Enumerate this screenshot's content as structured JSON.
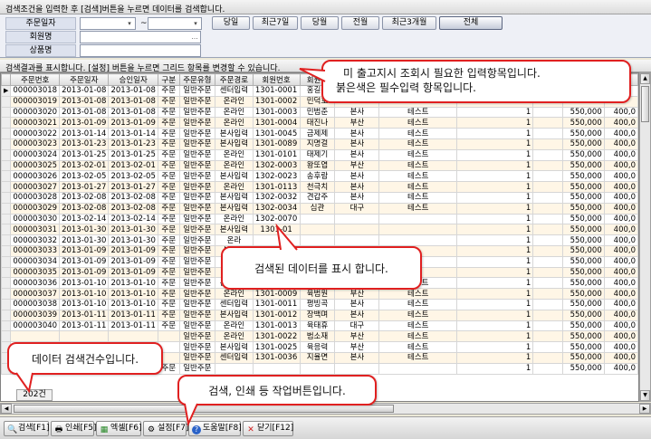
{
  "top_hint": "검색조건을 입력한 후 [검색]버튼을 누르면 데이터를 검색합니다.",
  "search": {
    "order_date_label": "주문일자",
    "member_label": "회원명",
    "product_label": "상품명",
    "tilde": "~",
    "dropdown_glyph": "▾",
    "member_btn_glyph": "…",
    "period_buttons": [
      "당일",
      "최근7일",
      "당월",
      "전월",
      "최근3개월",
      "전체"
    ]
  },
  "grid_hint": "검색결과를 표시합니다. [설정] 버튼을 누르면 그리드 항목를 변경할 수 있습니다.",
  "grid": {
    "indicator": "▶",
    "columns": [
      "주문번호",
      "주문일자",
      "승인일자",
      "구분",
      "주문유형",
      "주문경로",
      "회원번호",
      "회원명",
      "",
      "",
      "",
      "",
      "",
      ""
    ],
    "rows": [
      [
        "000003018",
        "2013-01-08",
        "2013-01-08",
        "주문",
        "일반주문",
        "센터입력",
        "1301-0001",
        "홍길동",
        "",
        "",
        "",
        "",
        "",
        ""
      ],
      [
        "000003019",
        "2013-01-08",
        "2013-01-08",
        "주문",
        "일반주문",
        "온라인",
        "1301-0002",
        "민덕호",
        "",
        "",
        "",
        "",
        "",
        ""
      ],
      [
        "000003020",
        "2013-01-08",
        "2013-01-08",
        "주문",
        "일반주문",
        "온라인",
        "1301-0003",
        "민범춘",
        "본사",
        "테스트",
        "1",
        "",
        "550,000",
        "400,0"
      ],
      [
        "000003021",
        "2013-01-09",
        "2013-01-09",
        "주문",
        "일반주문",
        "온라인",
        "1301-0004",
        "태진나",
        "부산",
        "테스트",
        "1",
        "",
        "550,000",
        "400,0"
      ],
      [
        "000003022",
        "2013-01-14",
        "2013-01-14",
        "주문",
        "일반주문",
        "본사입력",
        "1301-0045",
        "금제제",
        "본사",
        "테스트",
        "1",
        "",
        "550,000",
        "400,0"
      ],
      [
        "000003023",
        "2013-01-23",
        "2013-01-23",
        "주문",
        "일반주문",
        "본사입력",
        "1301-0089",
        "지명걸",
        "본사",
        "테스트",
        "1",
        "",
        "550,000",
        "400,0"
      ],
      [
        "000003024",
        "2013-01-25",
        "2013-01-25",
        "주문",
        "일반주문",
        "온라인",
        "1301-0101",
        "태제기",
        "본사",
        "테스트",
        "1",
        "",
        "550,000",
        "400,0"
      ],
      [
        "000003025",
        "2013-02-01",
        "2013-02-01",
        "주문",
        "일반주문",
        "온라인",
        "1302-0003",
        "왕또엽",
        "부산",
        "테스트",
        "1",
        "",
        "550,000",
        "400,0"
      ],
      [
        "000003026",
        "2013-02-05",
        "2013-02-05",
        "주문",
        "일반주문",
        "본사입력",
        "1302-0023",
        "송후람",
        "본사",
        "테스트",
        "1",
        "",
        "550,000",
        "400,0"
      ],
      [
        "000003027",
        "2013-01-27",
        "2013-01-27",
        "주문",
        "일반주문",
        "온라인",
        "1301-0113",
        "천극치",
        "본사",
        "테스트",
        "1",
        "",
        "550,000",
        "400,0"
      ],
      [
        "000003028",
        "2013-02-08",
        "2013-02-08",
        "주문",
        "일반주문",
        "본사입력",
        "1302-0032",
        "견갑주",
        "본사",
        "테스트",
        "1",
        "",
        "550,000",
        "400,0"
      ],
      [
        "000003029",
        "2013-02-08",
        "2013-02-08",
        "주문",
        "일반주문",
        "본사입력",
        "1302-0034",
        "심관",
        "대구",
        "테스트",
        "1",
        "",
        "550,000",
        "400,0"
      ],
      [
        "000003030",
        "2013-02-14",
        "2013-02-14",
        "주문",
        "일반주문",
        "온라인",
        "1302-0070",
        "",
        "",
        "",
        "1",
        "",
        "550,000",
        "400,0"
      ],
      [
        "000003031",
        "2013-01-30",
        "2013-01-30",
        "주문",
        "일반주문",
        "본사입력",
        "1301-01",
        "",
        "",
        "",
        "1",
        "",
        "550,000",
        "400,0"
      ],
      [
        "000003032",
        "2013-01-30",
        "2013-01-30",
        "주문",
        "일반주문",
        "온라",
        "",
        "",
        "",
        "",
        "1",
        "",
        "550,000",
        "400,0"
      ],
      [
        "000003033",
        "2013-01-09",
        "2013-01-09",
        "주문",
        "일반주문",
        "본사입",
        "",
        "",
        "",
        "",
        "1",
        "",
        "550,000",
        "400,0"
      ],
      [
        "000003034",
        "2013-01-09",
        "2013-01-09",
        "주문",
        "일반주문",
        "본사입",
        "",
        "",
        "",
        "",
        "1",
        "",
        "550,000",
        "400,0"
      ],
      [
        "000003035",
        "2013-01-09",
        "2013-01-09",
        "주문",
        "일반주문",
        "센터입",
        "",
        "",
        "",
        "",
        "1",
        "",
        "550,000",
        "400,0"
      ],
      [
        "000003036",
        "2013-01-10",
        "2013-01-10",
        "주문",
        "일반주문",
        "본사입력",
        "1301-0008",
        "송민",
        "대구",
        "테스트",
        "1",
        "",
        "550,000",
        "400,0"
      ],
      [
        "000003037",
        "2013-01-10",
        "2013-01-10",
        "주문",
        "일반주문",
        "온라인",
        "1301-0009",
        "육범원",
        "부산",
        "테스트",
        "1",
        "",
        "550,000",
        "400,0"
      ],
      [
        "000003038",
        "2013-01-10",
        "2013-01-10",
        "주문",
        "일반주문",
        "센터입력",
        "1301-0011",
        "평빙곡",
        "본사",
        "테스트",
        "1",
        "",
        "550,000",
        "400,0"
      ],
      [
        "000003039",
        "2013-01-11",
        "2013-01-11",
        "주문",
        "일반주문",
        "본사입력",
        "1301-0012",
        "장백며",
        "본사",
        "테스트",
        "1",
        "",
        "550,000",
        "400,0"
      ],
      [
        "000003040",
        "2013-01-11",
        "2013-01-11",
        "주문",
        "일반주문",
        "온라인",
        "1301-0013",
        "육태휴",
        "대구",
        "테스트",
        "1",
        "",
        "550,000",
        "400,0"
      ],
      [
        "",
        "",
        "",
        "",
        "일반주문",
        "온라인",
        "1301-0022",
        "범소재",
        "부산",
        "테스트",
        "1",
        "",
        "550,000",
        "400,0"
      ],
      [
        "",
        "",
        "",
        "",
        "일반주문",
        "본사입력",
        "1301-0025",
        "육응력",
        "부산",
        "테스트",
        "1",
        "",
        "550,000",
        "400,0"
      ],
      [
        "",
        "",
        "",
        "",
        "일반주문",
        "센터입력",
        "1301-0036",
        "지율면",
        "본사",
        "테스트",
        "1",
        "",
        "550,000",
        "400,0"
      ],
      [
        "000003044",
        "2013-01-13",
        "2013-01-13",
        "주문",
        "일반주문",
        "",
        "",
        "",
        "",
        "",
        "1",
        "",
        "550,000",
        "400,0"
      ]
    ],
    "count": "202건"
  },
  "toolbar": {
    "buttons": [
      {
        "label": "검색[F1]",
        "icon": "🔍"
      },
      {
        "label": "인쇄[F5]",
        "icon": "🖶"
      },
      {
        "label": "엑셀[F6]",
        "icon": "▦"
      },
      {
        "label": "설정[F7]",
        "icon": "⚙"
      },
      {
        "label": "도움말[F8]",
        "icon": "?"
      },
      {
        "label": "닫기[F12]",
        "icon": "✕"
      }
    ]
  },
  "callouts": {
    "required": [
      "미 출고지시 조회시 필요한 입력항목입니다.",
      "붉은색은 필수입력 항목입니다."
    ],
    "grid": "검색된 데이터를 표시 합니다.",
    "count": "데이터 검색건수입니다.",
    "toolbar": "검색, 인쇄 등 작업버튼입니다."
  },
  "colors": {
    "callout_border": "#e02020",
    "row_alt": "#fff6e6"
  }
}
